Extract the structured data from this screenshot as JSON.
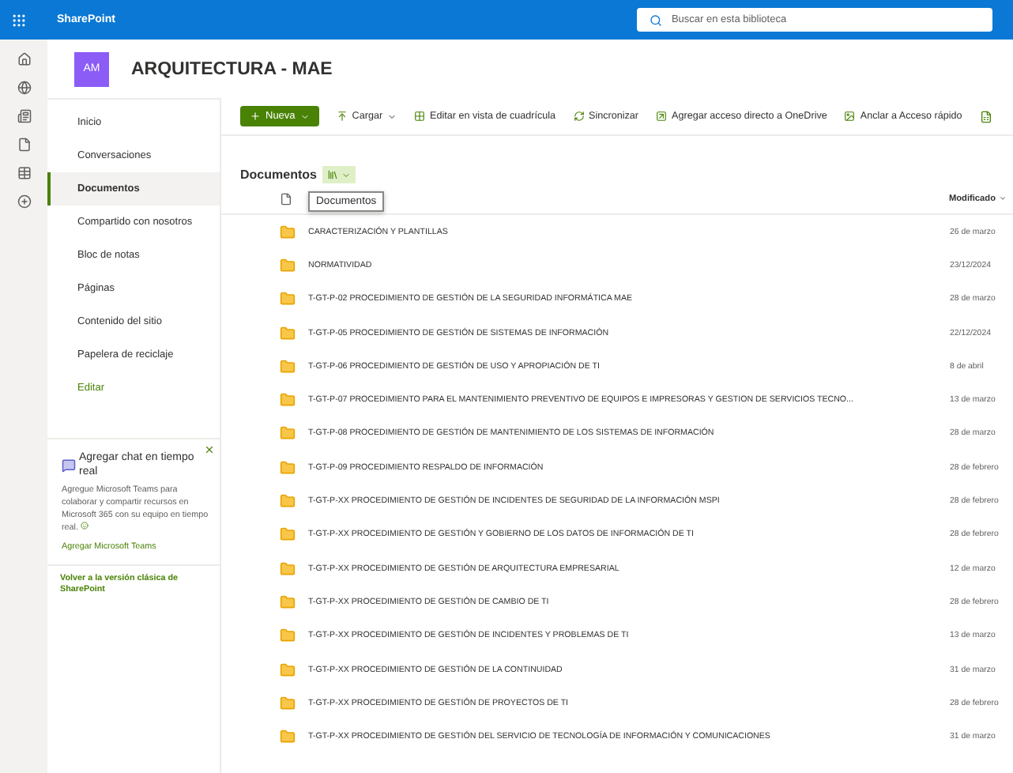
{
  "top_bar": {
    "app_name": "SharePoint",
    "search": {
      "placeholder": "Buscar en esta biblioteca"
    }
  },
  "site": {
    "avatar": "AM",
    "title": "ARQUITECTURA - MAE"
  },
  "nav": {
    "items": [
      {
        "label": "Inicio",
        "selected": false,
        "kind": "link"
      },
      {
        "label": "Conversaciones",
        "selected": false,
        "kind": "link"
      },
      {
        "label": "Documentos",
        "selected": true,
        "kind": "link"
      },
      {
        "label": "Compartido con nosotros",
        "selected": false,
        "kind": "link"
      },
      {
        "label": "Bloc de notas",
        "selected": false,
        "kind": "link"
      },
      {
        "label": "Páginas",
        "selected": false,
        "kind": "link"
      },
      {
        "label": "Contenido del sitio",
        "selected": false,
        "kind": "link"
      },
      {
        "label": "Papelera de reciclaje",
        "selected": false,
        "kind": "link"
      },
      {
        "label": "Editar",
        "selected": false,
        "kind": "edit"
      }
    ]
  },
  "teams_card": {
    "title": "Agregar chat en tiempo real",
    "body": "Agregue Microsoft Teams para colaborar y compartir recursos en Microsoft 365 con su equipo en tiempo real.",
    "link": "Agregar Microsoft Teams"
  },
  "classic_link": "Volver a la versión clásica de SharePoint",
  "toolbar": {
    "new_button": "Nueva",
    "actions": [
      {
        "label": "Cargar",
        "kind": "upload"
      },
      {
        "label": "Editar en vista de cuadrícula",
        "kind": "grid"
      },
      {
        "label": "Sincronizar",
        "kind": "sync"
      },
      {
        "label": "Agregar acceso directo a OneDrive",
        "kind": "shortcut"
      },
      {
        "label": "Anclar a Acceso rápido",
        "kind": "pin"
      }
    ]
  },
  "library": {
    "title": "Documentos",
    "tooltip": "Documentos",
    "modified_column": "Modificado",
    "rows": [
      {
        "name": "CARACTERIZACIÓN Y PLANTILLAS",
        "modified": "26 de marzo"
      },
      {
        "name": "NORMATIVIDAD",
        "modified": "23/12/2024"
      },
      {
        "name": "T-GT-P-02 PROCEDIMIENTO DE GESTIÓN DE LA SEGURIDAD INFORMÁTICA MAE",
        "modified": "28 de marzo"
      },
      {
        "name": "T-GT-P-05 PROCEDIMIENTO DE GESTIÓN DE SISTEMAS DE INFORMACIÓN",
        "modified": "22/12/2024"
      },
      {
        "name": "T-GT-P-06 PROCEDIMIENTO DE GESTIÓN DE USO Y APROPIACIÓN DE TI",
        "modified": "8 de abril"
      },
      {
        "name": "T-GT-P-07 PROCEDIMIENTO PARA EL MANTENIMIENTO PREVENTIVO DE EQUIPOS E IMPRESORAS Y GESTION DE SERVICIOS TECNO...",
        "modified": "13 de marzo"
      },
      {
        "name": "T-GT-P-08 PROCEDIMIENTO DE GESTIÓN DE MANTENIMIENTO DE LOS SISTEMAS DE INFORMACIÓN",
        "modified": "28 de marzo"
      },
      {
        "name": "T-GT-P-09 PROCEDIMIENTO RESPALDO DE INFORMACIÓN",
        "modified": "28 de febrero"
      },
      {
        "name": "T-GT-P-XX PROCEDIMIENTO DE GESTIÓN DE INCIDENTES DE SEGURIDAD DE LA INFORMACIÓN MSPI",
        "modified": "28 de febrero"
      },
      {
        "name": "T-GT-P-XX PROCEDIMIENTO DE GESTIÓN Y GOBIERNO DE LOS DATOS DE INFORMACIÓN DE TI",
        "modified": "28 de febrero"
      },
      {
        "name": "T-GT-P-XX PROCEDIMIENTO DE GESTIÓN DE ARQUITECTURA EMPRESARIAL",
        "modified": "12 de marzo"
      },
      {
        "name": "T-GT-P-XX PROCEDIMIENTO DE GESTIÓN DE CAMBIO DE TI",
        "modified": "28 de febrero"
      },
      {
        "name": "T-GT-P-XX PROCEDIMIENTO DE GESTIÓN DE INCIDENTES Y PROBLEMAS DE TI",
        "modified": "13 de marzo"
      },
      {
        "name": "T-GT-P-XX PROCEDIMIENTO DE GESTIÓN DE LA CONTINUIDAD",
        "modified": "31 de marzo"
      },
      {
        "name": "T-GT-P-XX PROCEDIMIENTO DE GESTIÓN DE PROYECTOS DE TI",
        "modified": "28 de febrero"
      },
      {
        "name": "T-GT-P-XX PROCEDIMIENTO DE GESTIÓN DEL SERVICIO DE TECNOLOGÍA DE INFORMACIÓN Y COMUNICACIONES",
        "modified": "31 de marzo"
      }
    ]
  }
}
